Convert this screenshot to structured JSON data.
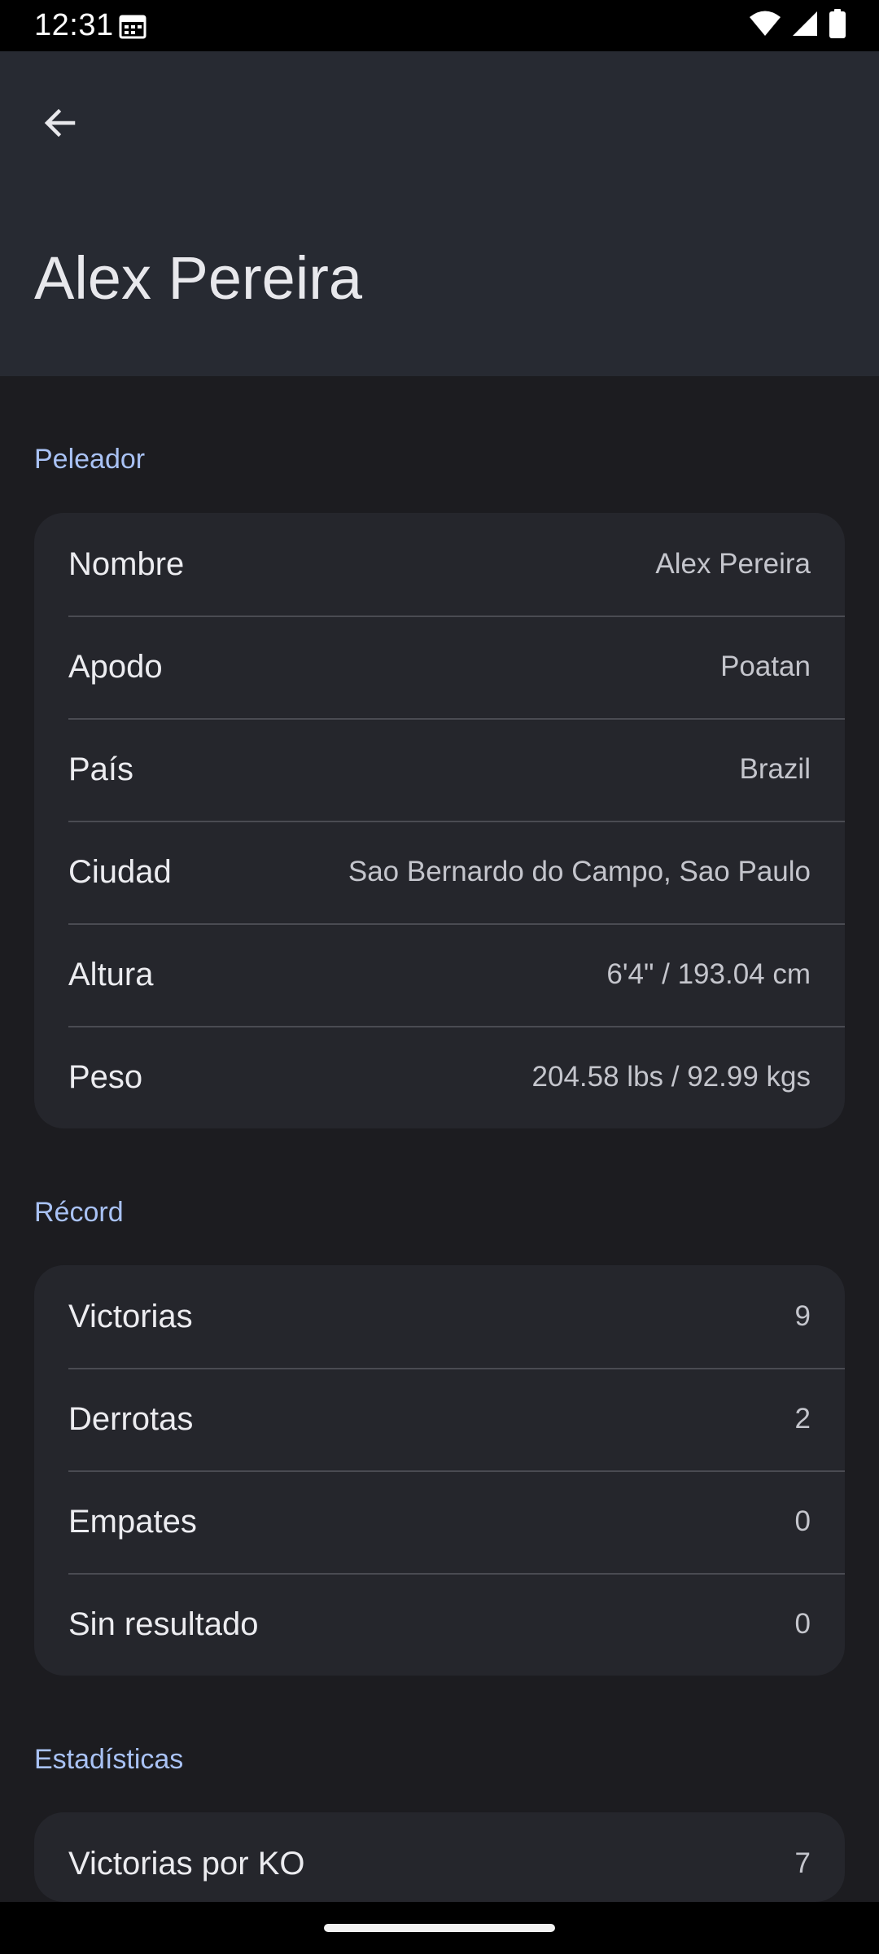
{
  "status_bar": {
    "time": "12:31",
    "icons": [
      "calendar-icon",
      "wifi-icon",
      "signal-icon",
      "battery-icon"
    ]
  },
  "app_bar": {
    "back_icon": "arrow-back-icon",
    "title": "Alex Pereira"
  },
  "sections": {
    "fighter": {
      "title": "Peleador",
      "rows": [
        {
          "label": "Nombre",
          "value": "Alex Pereira"
        },
        {
          "label": "Apodo",
          "value": "Poatan"
        },
        {
          "label": "País",
          "value": "Brazil"
        },
        {
          "label": "Ciudad",
          "value": "Sao Bernardo do Campo, Sao Paulo"
        },
        {
          "label": "Altura",
          "value": "6'4\" / 193.04 cm"
        },
        {
          "label": "Peso",
          "value": "204.58 lbs / 92.99 kgs"
        }
      ]
    },
    "record": {
      "title": "Récord",
      "rows": [
        {
          "label": "Victorias",
          "value": "9"
        },
        {
          "label": "Derrotas",
          "value": "2"
        },
        {
          "label": "Empates",
          "value": "0"
        },
        {
          "label": "Sin resultado",
          "value": "0"
        }
      ]
    },
    "stats": {
      "title": "Estadísticas",
      "rows": [
        {
          "label": "Victorias por KO",
          "value": "7"
        }
      ]
    }
  },
  "colors": {
    "background": "#1c1c20",
    "app_bar": "#272a32",
    "card": "#25262c",
    "section_header": "#a9c2f5"
  }
}
